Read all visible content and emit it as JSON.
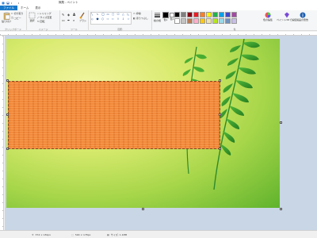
{
  "titlebar": {
    "title": "無題 - ペイント"
  },
  "menu": {
    "tabs": [
      "ファイル",
      "ホーム",
      "表示"
    ]
  },
  "ribbon": {
    "groups": {
      "clipboard": "クリップボード",
      "image": "イメージ",
      "tools": "ツール",
      "shapes": "図形",
      "colors": "色"
    },
    "clipboard": {
      "paste_label": "貼り付け",
      "cut_label": "切り取り",
      "copy_label": "コピー"
    },
    "image": {
      "select_label": "選択",
      "crop_label": "トリミング",
      "resize_label": "サイズ変更",
      "rotate_label": "回転"
    },
    "tools": {
      "brushes_label": "ブラシ"
    },
    "shapes": {
      "outline_label": "枠線",
      "fill_label": "塗りつぶし"
    },
    "colors": {
      "size_label": "線の幅",
      "color1_label": "色1",
      "color2_label": "色2",
      "edit_colors_label": "色の編集",
      "paint3d_label": "ペイント3Dで編集",
      "product_alert_label": "製品の警告"
    },
    "palette": [
      "#000000",
      "#7f7f7f",
      "#880015",
      "#ed1c24",
      "#ff7f27",
      "#fff200",
      "#22b14c",
      "#00a2e8",
      "#3f48cc",
      "#a349a4",
      "#ffffff",
      "#c3c3c3",
      "#b97a57",
      "#ffaec9",
      "#ffc90e",
      "#efe4b0",
      "#b5e61d",
      "#99d9ea",
      "#7092be",
      "#c8bfe7"
    ]
  },
  "statusbar": {
    "position": "374 × 181px",
    "selection_size": "590 × 178px",
    "file_size": "サイズ: 1.1MB"
  }
}
